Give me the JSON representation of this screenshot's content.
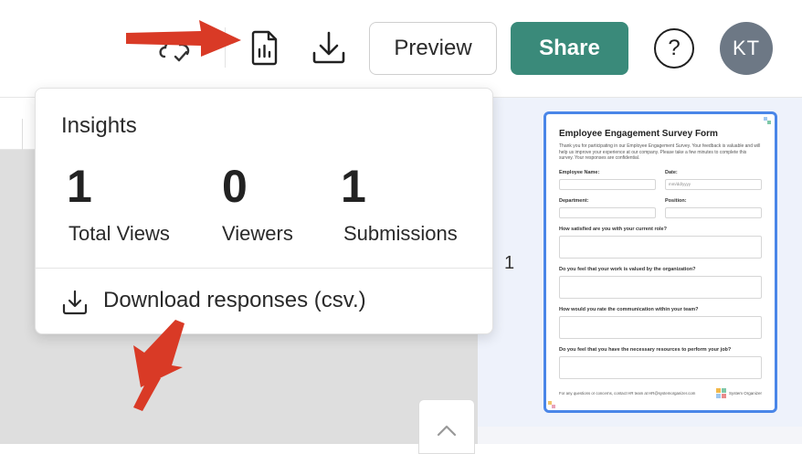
{
  "header": {
    "preview_label": "Preview",
    "share_label": "Share",
    "help_label": "?",
    "avatar_initials": "KT",
    "share_color": "#3a8a7a"
  },
  "insights": {
    "title": "Insights",
    "stats": [
      {
        "value": "1",
        "label": "Total Views"
      },
      {
        "value": "0",
        "label": "Viewers"
      },
      {
        "value": "1",
        "label": "Submissions"
      }
    ],
    "download_label": "Download responses (csv.)"
  },
  "pages_panel": {
    "page_number": "1",
    "thumbnail": {
      "title": "Employee Engagement Survey Form",
      "intro": "Thank you for participating in our Employee Engagement Survey. Your feedback is valuable and will help us improve your experience at our company. Please take a few minutes to complete this survey. Your responses are confidential.",
      "fields": {
        "employee_name": "Employee Name:",
        "date": "Date:",
        "date_placeholder": "mm/dd/yyyy",
        "department": "Department:",
        "position": "Position:"
      },
      "questions": [
        "How satisfied are you with your current role?",
        "Do you feel that your work is valued by the organization?",
        "How would you rate the communication within your team?",
        "Do you feel that you have the necessary resources to perform your job?"
      ],
      "footer_text": "For any questions or concerns, contact HR team at HR@systemorganizer.com",
      "brand_name": "System Organizer"
    }
  },
  "annotations": {
    "arrow_color": "#d93a26"
  }
}
